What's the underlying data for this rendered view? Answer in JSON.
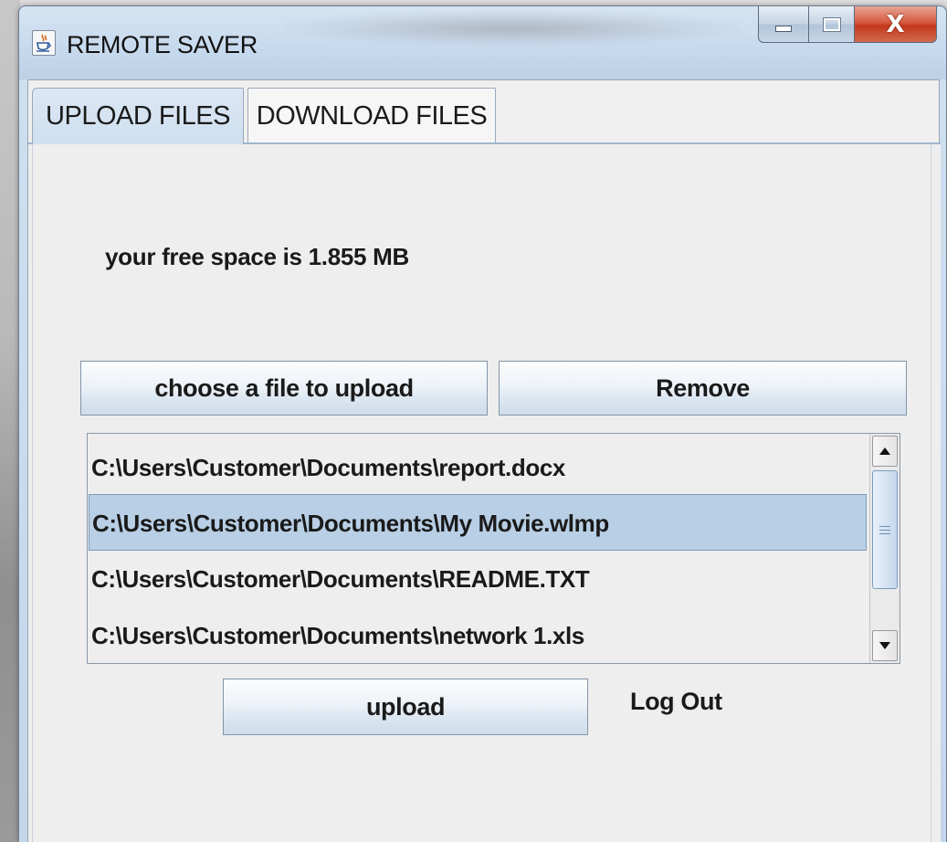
{
  "window": {
    "title": "REMOTE SAVER",
    "icon": "java-app-icon",
    "controls": {
      "minimize_icon": "minimize-icon",
      "maximize_icon": "maximize-icon",
      "close_glyph": "X"
    }
  },
  "tabs": [
    {
      "label": "UPLOAD FILES",
      "selected": true
    },
    {
      "label": "DOWNLOAD FILES",
      "selected": false
    }
  ],
  "upload_panel": {
    "free_space_text": "your free space is 1.855 MB",
    "choose_button_label": "choose a file to upload",
    "remove_button_label": "Remove",
    "files": [
      {
        "path": "C:\\Users\\Customer\\Documents\\report.docx",
        "selected": false
      },
      {
        "path": "C:\\Users\\Customer\\Documents\\My Movie.wlmp",
        "selected": true
      },
      {
        "path": "C:\\Users\\Customer\\Documents\\README.TXT",
        "selected": false
      },
      {
        "path": "C:\\Users\\Customer\\Documents\\network 1.xls",
        "selected": false
      }
    ],
    "upload_button_label": "upload",
    "logout_label": "Log Out"
  },
  "colors": {
    "selection": "#b8cfe5",
    "close_button": "#c4391d",
    "panel_bg": "#eeeeee"
  }
}
